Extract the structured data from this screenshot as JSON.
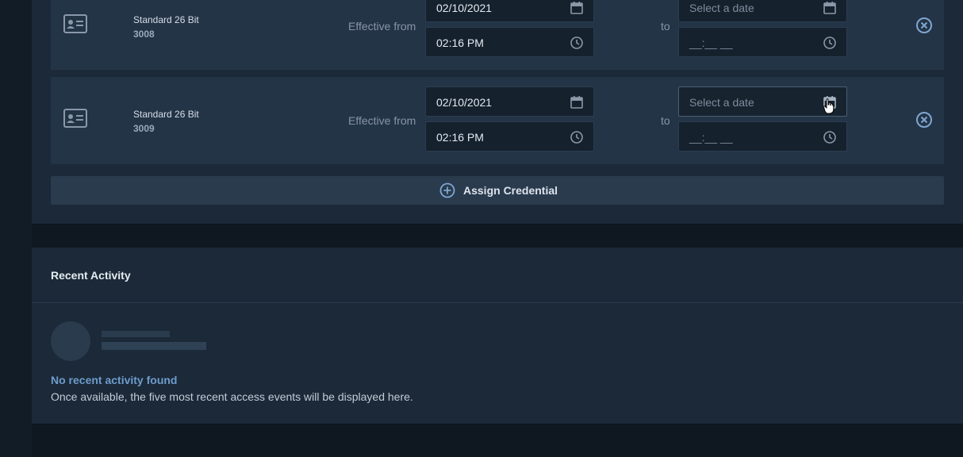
{
  "credentials": [
    {
      "name": "Standard 26 Bit",
      "number": "3008",
      "effective_label": "Effective from",
      "from_date": "02/10/2021",
      "from_time": "02:16 PM",
      "to_label": "to",
      "to_date_placeholder": "Select a date",
      "to_time_placeholder": "__:__ __"
    },
    {
      "name": "Standard 26 Bit",
      "number": "3009",
      "effective_label": "Effective from",
      "from_date": "02/10/2021",
      "from_time": "02:16 PM",
      "to_label": "to",
      "to_date_placeholder": "Select a date",
      "to_time_placeholder": "__:__ __"
    }
  ],
  "assign_button": {
    "label": "Assign Credential"
  },
  "recent_activity": {
    "title": "Recent Activity",
    "empty_title": "No recent activity found",
    "empty_description": "Once available, the five most recent access events will be displayed here."
  },
  "icons": {
    "card": "id-card-icon",
    "calendar": "calendar-icon",
    "clock": "clock-icon",
    "remove": "close-circle-icon",
    "add": "plus-circle-icon"
  },
  "colors": {
    "accent": "#6e9ccc",
    "icon": "#8a98a8",
    "remove_icon": "#7fa6d1"
  }
}
